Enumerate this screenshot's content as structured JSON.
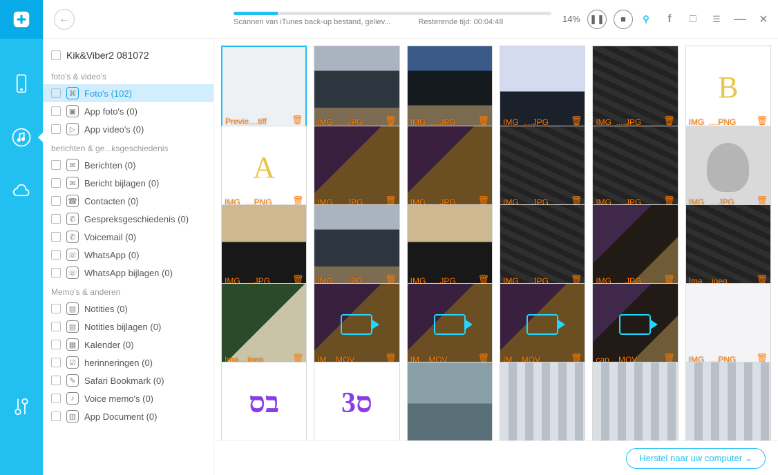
{
  "header": {
    "progress_percent": 14,
    "percent_label": "14%",
    "status_text": "Scannen van iTunes back-up bestand, geliev...",
    "remaining_label": "Resterende tijd:",
    "remaining_time": "00:04:48"
  },
  "tree": {
    "device_label": "Kik&Viber2 081072",
    "sections": [
      {
        "label": "foto's & video's",
        "items": [
          {
            "label": "Foto's (102)",
            "selected": true,
            "glyph": "⌘"
          },
          {
            "label": "App foto's (0)",
            "glyph": "▣"
          },
          {
            "label": "App video's (0)",
            "glyph": "▷"
          }
        ]
      },
      {
        "label": "berichten & ge...ksgeschiedenis",
        "items": [
          {
            "label": "Berichten (0)",
            "glyph": "✉"
          },
          {
            "label": "Bericht bijlagen (0)",
            "glyph": "✉"
          },
          {
            "label": "Contacten (0)",
            "glyph": "☎"
          },
          {
            "label": "Gespreksgeschiedenis (0)",
            "glyph": "✆"
          },
          {
            "label": "Voicemail (0)",
            "glyph": "✆"
          },
          {
            "label": "WhatsApp (0)",
            "glyph": "☏"
          },
          {
            "label": "WhatsApp bijlagen (0)",
            "glyph": "☏"
          }
        ]
      },
      {
        "label": "Memo's & anderen",
        "items": [
          {
            "label": "Notities (0)",
            "glyph": "▤"
          },
          {
            "label": "Notities bijlagen (0)",
            "glyph": "▤"
          },
          {
            "label": "Kalender (0)",
            "glyph": "▦"
          },
          {
            "label": "herinneringen (0)",
            "glyph": "☑"
          },
          {
            "label": "Safari Bookmark (0)",
            "glyph": "✎"
          },
          {
            "label": "Voice memo's (0)",
            "glyph": "♪"
          },
          {
            "label": "App Document (0)",
            "glyph": "▥"
          }
        ]
      }
    ]
  },
  "thumbnails": [
    {
      "caption": "Previe....tiff",
      "bg": "bg-screenshot",
      "selected": true
    },
    {
      "caption": "IMG_....JPG",
      "bg": "bg-monitor"
    },
    {
      "caption": "IMG_....JPG",
      "bg": "bg-dualmonitor"
    },
    {
      "caption": "IMG_....JPG",
      "bg": "bg-fb"
    },
    {
      "caption": "IMG_....JPG",
      "bg": "bg-kb"
    },
    {
      "caption": "IMG_....PNG",
      "bg": "bg-letter",
      "letter": "B"
    },
    {
      "caption": "IMG_....PNG",
      "bg": "bg-letter",
      "letter": "A"
    },
    {
      "caption": "IMG_....JPG",
      "bg": "bg-snack"
    },
    {
      "caption": "IMG_....JPG",
      "bg": "bg-snack"
    },
    {
      "caption": "IMG_....JPG",
      "bg": "bg-kb"
    },
    {
      "caption": "IMG_....JPG",
      "bg": "bg-kb"
    },
    {
      "caption": "IMG_....JPG",
      "bg": "bg-avatar"
    },
    {
      "caption": "IMG_....JPG",
      "bg": "bg-figurine"
    },
    {
      "caption": "IMG_....JPG",
      "bg": "bg-monitor"
    },
    {
      "caption": "IMG_....JPG",
      "bg": "bg-figurine"
    },
    {
      "caption": "IMG_....JPG",
      "bg": "bg-kb"
    },
    {
      "caption": "IMG_....JPG",
      "bg": "bg-snack2"
    },
    {
      "caption": "Ima....jpeg",
      "bg": "bg-kb"
    },
    {
      "caption": "Ima....jpeg",
      "bg": "bg-plant"
    },
    {
      "caption": "IM....MOV",
      "bg": "bg-snack",
      "video": true
    },
    {
      "caption": "IM....MOV",
      "bg": "bg-snack",
      "video": true
    },
    {
      "caption": "IM....MOV",
      "bg": "bg-snack",
      "video": true
    },
    {
      "caption": "cap....MOV",
      "bg": "bg-snack2",
      "video": true
    },
    {
      "caption": "IMG_....PNG",
      "bg": "bg-chat"
    },
    {
      "caption": "",
      "bg": "bg-purple",
      "letter": "בס"
    },
    {
      "caption": "",
      "bg": "bg-purple",
      "letter": "ס3"
    },
    {
      "caption": "",
      "bg": "bg-water"
    },
    {
      "caption": "",
      "bg": "bg-window"
    },
    {
      "caption": "",
      "bg": "bg-window"
    },
    {
      "caption": "",
      "bg": "bg-window"
    }
  ],
  "footer": {
    "restore_label": "Herstel naar uw computer"
  }
}
